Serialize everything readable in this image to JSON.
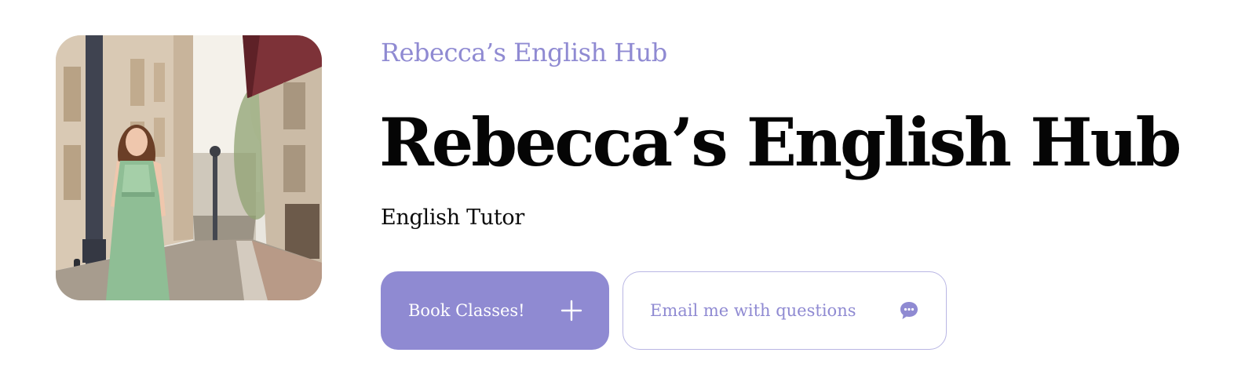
{
  "brand": {
    "name": "Rebecca’s English Hub"
  },
  "hero": {
    "title": "Rebecca’s English Hub",
    "subtitle": "English Tutor",
    "photo_icon": "tutor-portrait-photo"
  },
  "actions": {
    "primary": {
      "label": "Book Classes!",
      "icon": "plus-icon"
    },
    "secondary": {
      "label": "Email me with questions",
      "icon": "chat-bubble-icon"
    }
  },
  "colors": {
    "accent": "#8f8ad2",
    "accent_border": "#b9b6e4",
    "text": "#0a0a0a",
    "background": "#ffffff"
  }
}
